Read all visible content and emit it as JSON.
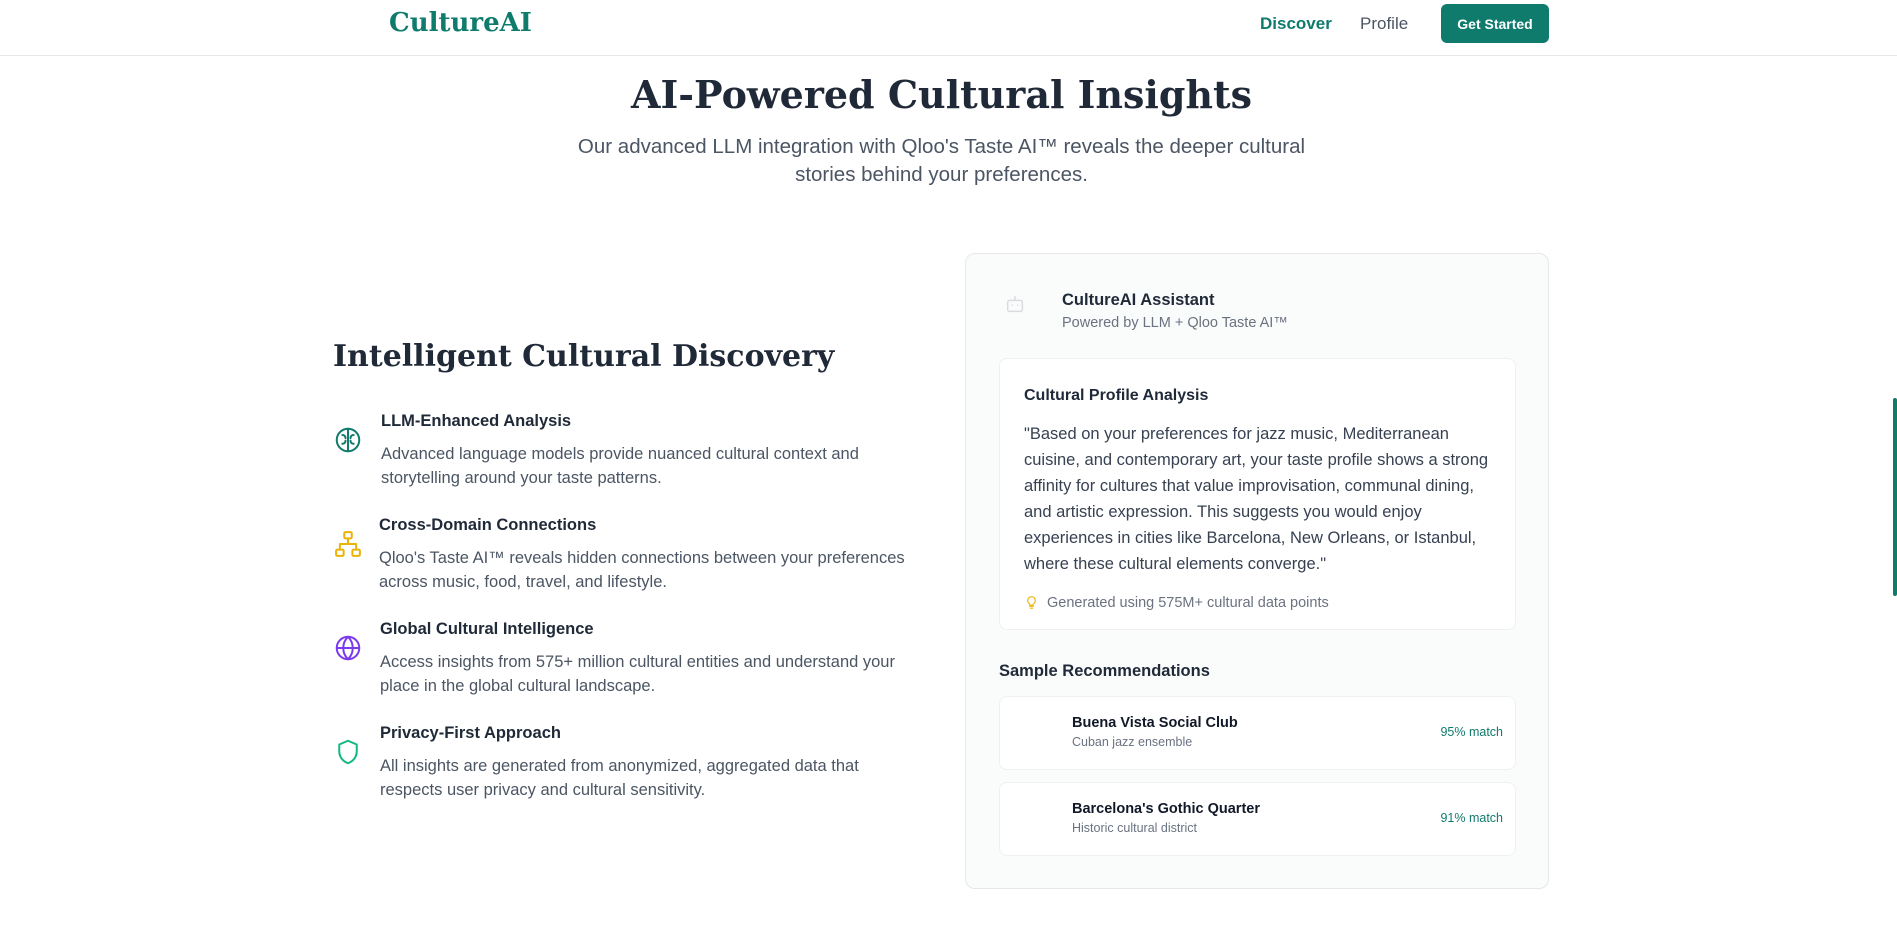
{
  "header": {
    "logo": "CultureAI",
    "nav": [
      {
        "label": "Discover"
      },
      {
        "label": "Profile"
      }
    ],
    "cta_label": "Get Started"
  },
  "hero": {
    "title": "AI-Powered Cultural Insights",
    "subtitle": "Our advanced LLM integration with Qloo's Taste AI™ reveals the deeper cultural stories behind your preferences."
  },
  "discovery": {
    "title": "Intelligent Cultural Discovery",
    "features": [
      {
        "icon": "brain-icon",
        "title": "LLM-Enhanced Analysis",
        "description": "Advanced language models provide nuanced cultural context and storytelling around your taste patterns.",
        "color": "#0f7b6c"
      },
      {
        "icon": "network-icon",
        "title": "Cross-Domain Connections",
        "description": "Qloo's Taste AI™ reveals hidden connections between your preferences across music, food, travel, and lifestyle.",
        "color": "#eab308"
      },
      {
        "icon": "globe-icon",
        "title": "Global Cultural Intelligence",
        "description": "Access insights from 575+ million cultural entities and understand your place in the global cultural landscape.",
        "color": "#7c3aed"
      },
      {
        "icon": "shield-icon",
        "title": "Privacy-First Approach",
        "description": "All insights are generated from anonymized, aggregated data that respects user privacy and cultural sensitivity.",
        "color": "#10b981"
      }
    ]
  },
  "assistant": {
    "icon": "bot-icon",
    "name": "CultureAI Assistant",
    "subtitle": "Powered by LLM + Qloo Taste AI™",
    "analysis": {
      "title": "Cultural Profile Analysis",
      "quote": "\"Based on your preferences for jazz music, Mediterranean cuisine, and contemporary art, your taste profile shows a strong affinity for cultures that value improvisation, communal dining, and artistic expression. This suggests you would enjoy experiences in cities like Barcelona, New Orleans, or Istanbul, where these cultural elements converge.\"",
      "footnote": "Generated using 575M+ cultural data points",
      "footnote_icon": "lightbulb-icon"
    },
    "recommendations_title": "Sample Recommendations",
    "recommendations": [
      {
        "name": "Buena Vista Social Club",
        "type": "Cuban jazz ensemble",
        "match": "95% match"
      },
      {
        "name": "Barcelona's Gothic Quarter",
        "type": "Historic cultural district",
        "match": "91% match"
      }
    ]
  },
  "colors": {
    "brand": "#0f7b6c",
    "accent_yellow": "#eab308",
    "accent_purple": "#7c3aed",
    "accent_green": "#10b981"
  }
}
